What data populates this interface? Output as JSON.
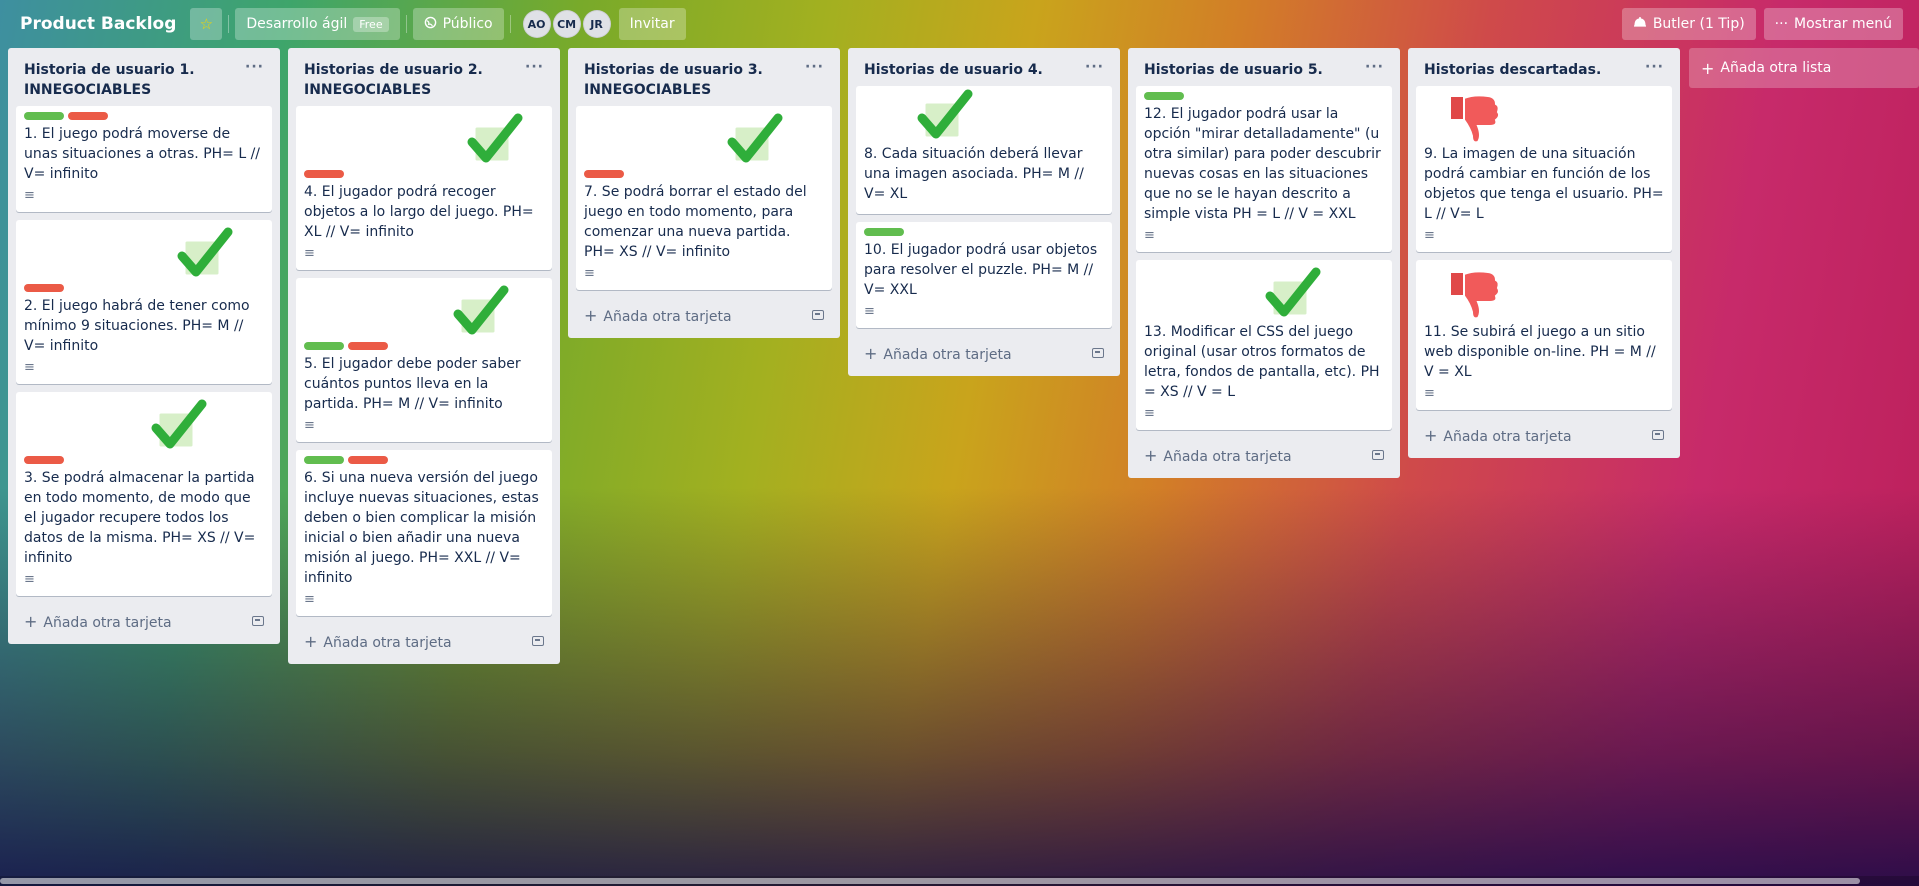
{
  "header": {
    "board_title": "Product Backlog",
    "team_name": "Desarrollo ágil",
    "team_badge": "Free",
    "visibility": "Público",
    "members": [
      "AO",
      "CM",
      "JR"
    ],
    "invite": "Invitar",
    "butler": "Butler (1 Tip)",
    "show_menu": "Mostrar menú"
  },
  "add_card_label": "Añada otra tarjeta",
  "add_list_label": "Añada otra lista",
  "lists": [
    {
      "title": "Historia de usuario 1. INNEGOCIABLES",
      "cards": [
        {
          "text": "1. El juego podrá moverse de unas situaciones a otras. PH= L // V= infinito"
        },
        {
          "text": "2. El juego habrá de tener como mínimo 9 situaciones. PH= M // V= infinito"
        },
        {
          "text": "3. Se podrá almacenar la partida en todo momento, de modo que el jugador recupere todos los datos de la misma. PH= XS // V= infinito"
        }
      ]
    },
    {
      "title": "Historias de usuario 2. INNEGOCIABLES",
      "cards": [
        {
          "text": "4. El jugador podrá recoger objetos a lo largo del juego. PH= XL // V= infinito"
        },
        {
          "text": "5. El jugador debe poder saber cuántos puntos lleva en la partida. PH= M // V= infinito"
        },
        {
          "text": "6. Si una nueva versión del juego incluye nuevas situaciones, estas deben o bien complicar la misión inicial o bien añadir una nueva misión al juego. PH= XXL // V= infinito"
        }
      ]
    },
    {
      "title": "Historias de usuario 3. INNEGOCIABLES",
      "cards": [
        {
          "text": "7. Se podrá borrar el estado del juego en todo momento, para comenzar una nueva partida. PH= XS // V= infinito"
        }
      ]
    },
    {
      "title": "Historias de usuario 4.",
      "cards": [
        {
          "text": "8. Cada situación deberá llevar una imagen asociada. PH= M // V= XL"
        },
        {
          "text": "10. El jugador podrá usar objetos para resolver el puzzle. PH= M // V= XXL"
        }
      ]
    },
    {
      "title": "Historias de usuario 5.",
      "cards": [
        {
          "text": "12. El jugador podrá usar la opción \"mirar detalladamente\" (u otra similar) para poder descubrir nuevas cosas en las situaciones que no se le hayan descrito a simple vista PH = L // V = XXL"
        },
        {
          "text": "13. Modificar el CSS del juego original (usar otros formatos de letra, fondos de pantalla, etc). PH = XS // V = L"
        }
      ]
    },
    {
      "title": "Historias descartadas.",
      "cards": [
        {
          "text": "9. La imagen de una situación podrá cambiar en función de los objetos que tenga el usuario. PH= L // V= L"
        },
        {
          "text": "11. Se subirá el juego a un sitio web disponible on-line. PH = M // V = XL"
        }
      ]
    }
  ],
  "colors": {
    "label_green": "#61bd4f",
    "label_red": "#eb5a46",
    "list_bg": "#ebecf0"
  }
}
